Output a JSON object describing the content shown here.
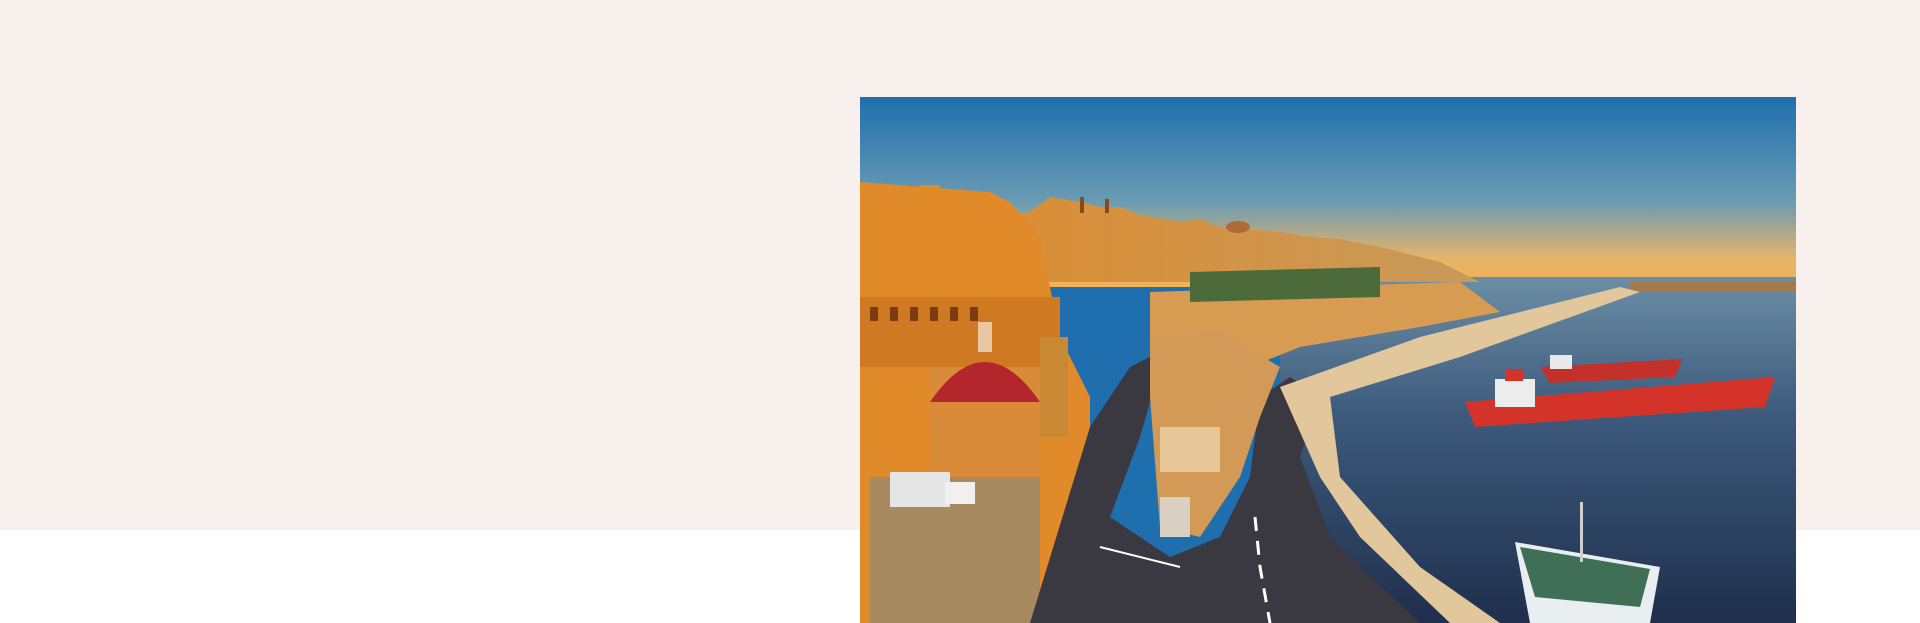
{
  "hero": {
    "image": {
      "subject": "harbour-city-sunset",
      "colors": {
        "sky_top": "#1f6fae",
        "sky_bottom": "#f3b155",
        "sea": "#2a3f63",
        "stone": "#d38a2f",
        "ship": "#d4332a"
      }
    }
  }
}
